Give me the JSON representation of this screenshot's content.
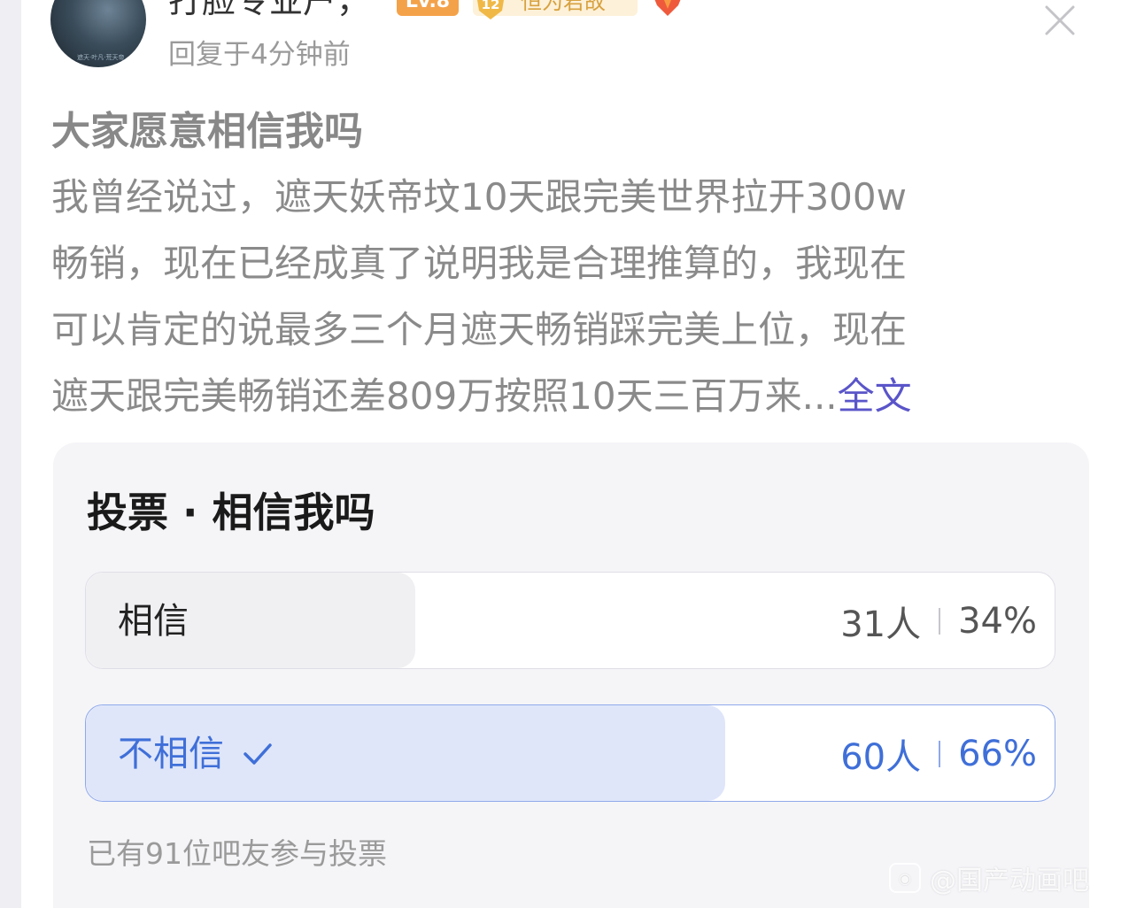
{
  "header": {
    "username": "打脸专业户，",
    "level": "Lv.8",
    "title_badge_number": "12",
    "title_badge": "恒为君故",
    "reply_time": "回复于4分钟前",
    "avatar_watermark": "遮天·叶凡·荒天帝"
  },
  "post": {
    "title": "大家愿意相信我吗",
    "lines": [
      "我曾经说过，遮天妖帝坟10天跟完美世界拉开300w",
      "畅销，现在已经成真了说明我是合理推算的，我现在",
      "可以肯定的说最多三个月遮天畅销踩完美上位，现在",
      "遮天跟完美畅销还差809万按照10天三百万来..."
    ],
    "read_more": "全文"
  },
  "poll": {
    "title": "投票 · 相信我吗",
    "options": [
      {
        "label": "相信",
        "count": "31人",
        "percent": "34%",
        "share": 0.34,
        "selected": false
      },
      {
        "label": "不相信",
        "count": "60人",
        "percent": "66%",
        "share": 0.66,
        "selected": true
      }
    ],
    "footer": "已有91位吧友参与投票"
  },
  "watermark": {
    "text": "@国产动画吧"
  },
  "colors": {
    "accent_blue": "#3f6fd8",
    "read_more": "#5a55c9",
    "level_badge": "#f4a24a",
    "title_badge_bg": "#fdf1d9",
    "title_badge_text": "#d7a13f"
  },
  "icons": [
    "avatar",
    "shield-icon",
    "medal-icon",
    "close-icon",
    "check-icon",
    "weibo-icon"
  ]
}
